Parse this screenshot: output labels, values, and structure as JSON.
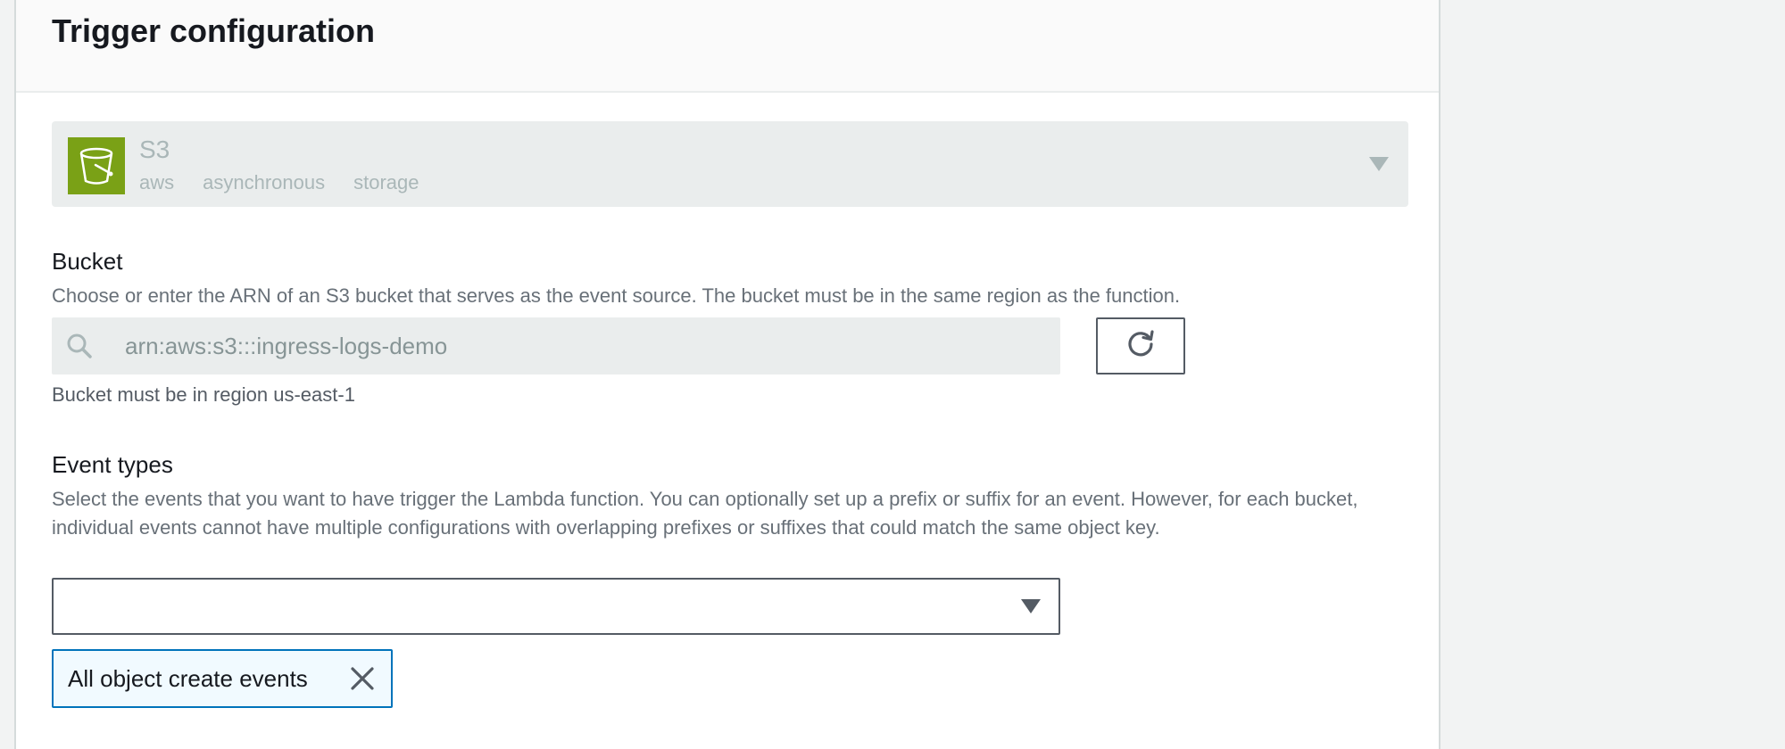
{
  "panel": {
    "title": "Trigger configuration"
  },
  "trigger": {
    "name": "S3",
    "tags": [
      "aws",
      "asynchronous",
      "storage"
    ],
    "icon": "s3-bucket-icon",
    "icon_color": "#7aa116"
  },
  "bucket": {
    "label": "Bucket",
    "description": "Choose or enter the ARN of an S3 bucket that serves as the event source. The bucket must be in the same region as the function.",
    "placeholder": "arn:aws:s3:::ingress-logs-demo",
    "value": "",
    "help": "Bucket must be in region us-east-1",
    "search_icon": "search-icon",
    "refresh_icon": "refresh-icon"
  },
  "event_types": {
    "label": "Event types",
    "description": "Select the events that you want to have trigger the Lambda function. You can optionally set up a prefix or suffix for an event. However, for each bucket, individual events cannot have multiple configurations with overlapping prefixes or suffixes that could match the same object key.",
    "selected_value": "",
    "tokens": [
      {
        "label": "All object create events"
      }
    ]
  },
  "colors": {
    "token_border": "#0073bb",
    "token_background": "#f1faff"
  }
}
